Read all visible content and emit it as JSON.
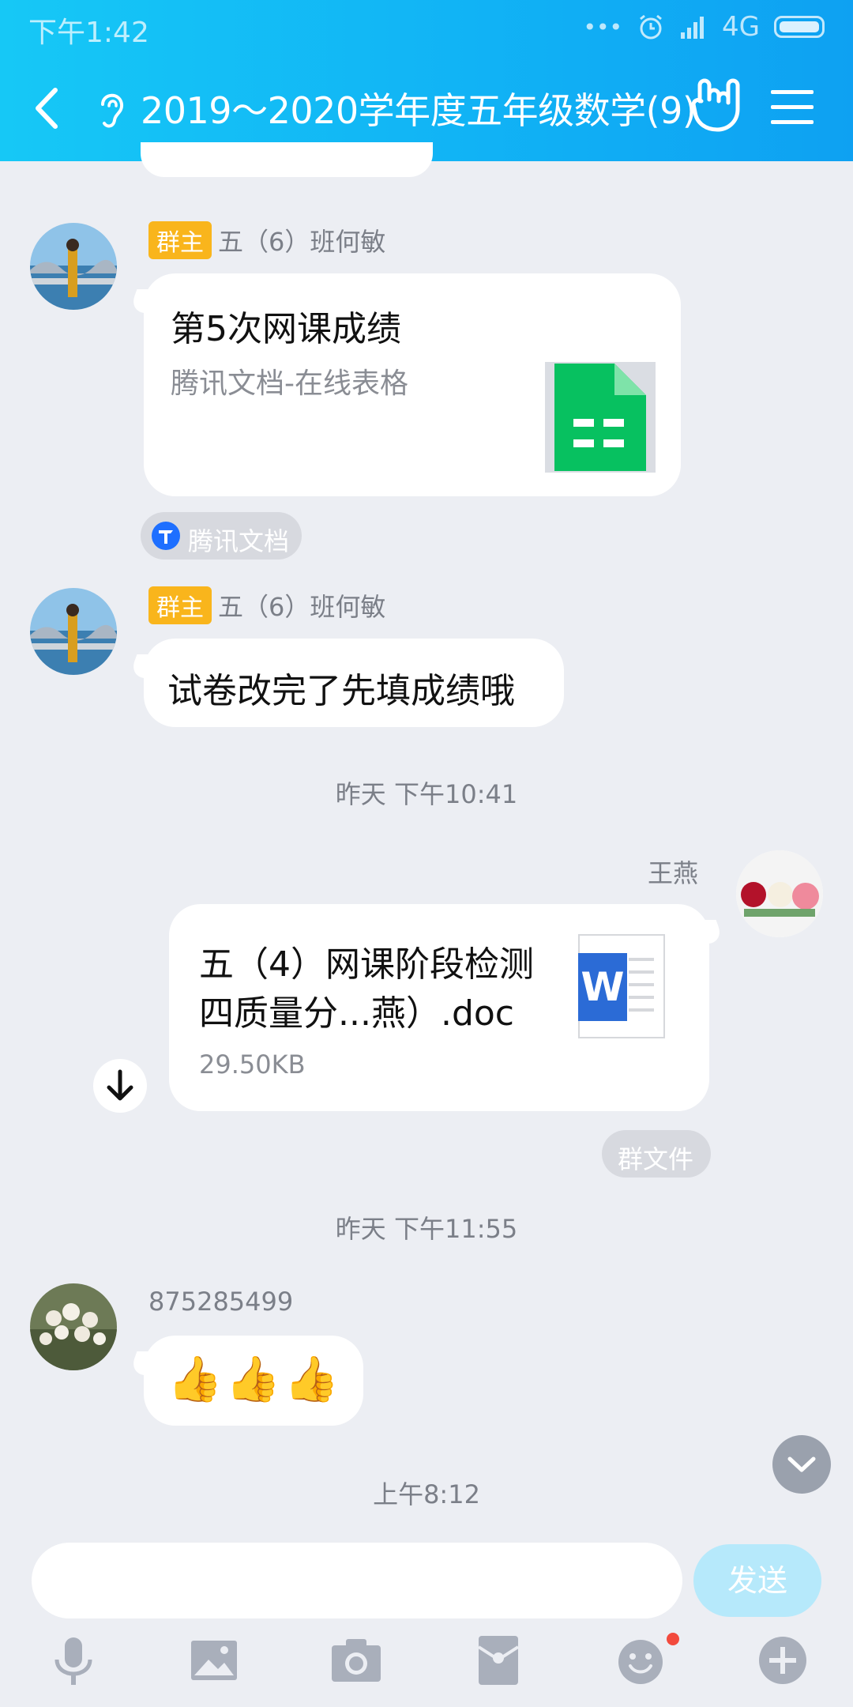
{
  "status_bar": {
    "time": "下午1:42",
    "dots": "•••",
    "network": "4G"
  },
  "header": {
    "title": "2019～2020学年度五年级数学(9)"
  },
  "messages": {
    "doc_share": {
      "badge": "群主",
      "sender": "五（6）班何敏",
      "title": "第5次网课成绩",
      "subtitle": "腾讯文档-在线表格",
      "source_tag": "腾讯文档"
    },
    "text_msg": {
      "badge": "群主",
      "sender": "五（6）班何敏",
      "text": "试卷改完了先填成绩哦"
    },
    "time1": "昨天 下午10:41",
    "file_msg": {
      "sender": "王燕",
      "filename_line1": "五（4）网课阶段检测",
      "filename_line2": "四质量分...燕）.doc",
      "size": "29.50KB",
      "word_icon_letter": "W",
      "source_tag": "群文件"
    },
    "time2": "昨天 下午11:55",
    "emoji_msg": {
      "sender": "875285499",
      "emojis": "👍👍👍"
    },
    "time3": "上午8:12"
  },
  "input": {
    "value": "",
    "send_label": "发送"
  },
  "colors": {
    "header": "#11b3f5",
    "background": "#eceef3",
    "badge": "#f9b51c",
    "sheet_green": "#07c160",
    "word_blue": "#2b6bd6",
    "send_disabled": "#b6e9fb"
  },
  "toolbar": {
    "icons": [
      "microphone-icon",
      "image-icon",
      "camera-icon",
      "red-packet-icon",
      "emoji-icon",
      "plus-icon"
    ]
  }
}
